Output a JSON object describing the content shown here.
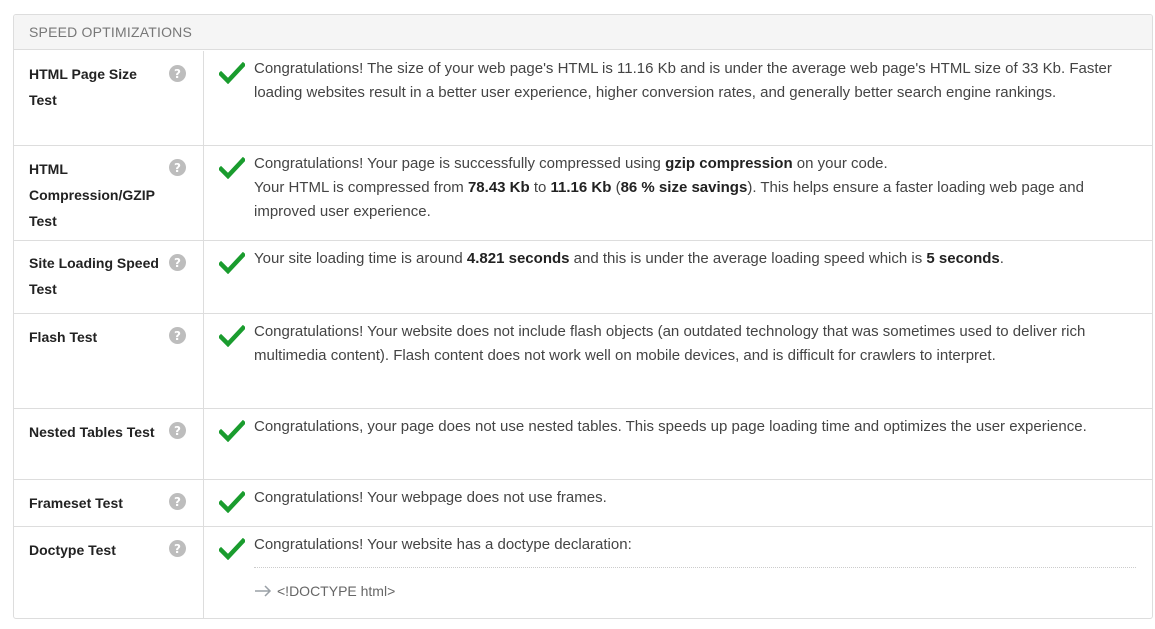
{
  "panel": {
    "title": "SPEED OPTIMIZATIONS"
  },
  "tests": [
    {
      "label": "HTML Page Size Test",
      "text": "Congratulations! The size of your web page's HTML is 11.16 Kb and is under the average web page's HTML size of 33 Kb. Faster loading websites result in a better user experience, higher conversion rates, and generally better search engine rankings."
    },
    {
      "label": "HTML Compression/GZIP Test",
      "line1_pre": "Congratulations! Your page is successfully compressed using ",
      "line1_bold": "gzip compression",
      "line1_post": " on your code.",
      "line2_pre": "Your HTML is compressed from ",
      "line2_from": "78.43 Kb",
      "line2_to_word": " to ",
      "line2_to": "11.16 Kb",
      "line2_paren_open": " (",
      "line2_savings": "86 % size savings",
      "line2_post": "). This helps ensure a faster loading web page and improved user experience."
    },
    {
      "label": "Site Loading Speed Test",
      "pre": "Your site loading time is around ",
      "time": "4.821 seconds",
      "mid": " and this is under the average loading speed which is ",
      "avg": "5 seconds",
      "post": "."
    },
    {
      "label": "Flash Test",
      "text": "Congratulations! Your website does not include flash objects (an outdated technology that was sometimes used to deliver rich multimedia content). Flash content does not work well on mobile devices, and is difficult for crawlers to interpret."
    },
    {
      "label": "Nested Tables Test",
      "text": "Congratulations, your page does not use nested tables. This speeds up page loading time and optimizes the user experience."
    },
    {
      "label": "Frameset Test",
      "text": "Congratulations! Your webpage does not use frames."
    },
    {
      "label": "Doctype Test",
      "text": "Congratulations! Your website has a doctype declaration:",
      "doctype": "<!DOCTYPE html>"
    }
  ],
  "icons": {
    "help": "question-circle-icon",
    "pass": "checkmark-icon",
    "arrow": "arrow-right-icon"
  },
  "colors": {
    "pass_green": "#1a9c2e",
    "help_gray": "#bdbdbd",
    "border": "#dddddd",
    "header_bg": "#f5f5f5"
  }
}
